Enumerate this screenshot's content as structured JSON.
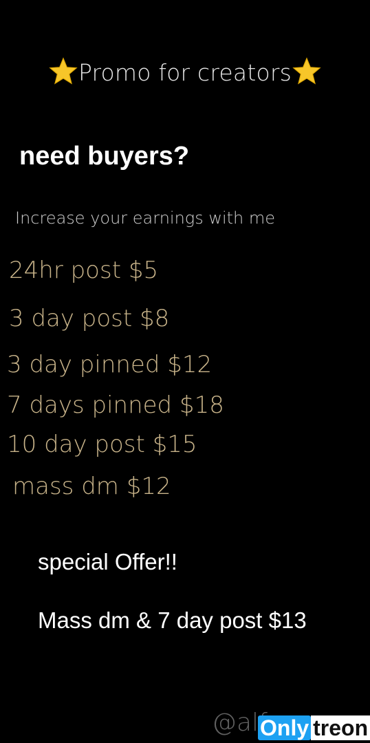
{
  "colors": {
    "background": "#000000",
    "heading": "#ffffff",
    "price_text": "#c9b48a",
    "star": "#f7c629",
    "brand_blue": "#1da1f2"
  },
  "header": {
    "title": "Promo for creators",
    "left_icon": "star-icon",
    "right_icon": "star-icon"
  },
  "headline": "need buyers?",
  "subline": "Increase your earnings with me",
  "prices": [
    "24hr post $5",
    "3 day post $8",
    "3 day pinned $12",
    "7 days pinned $18",
    "10 day post $15",
    "mass dm $12"
  ],
  "offer": {
    "title": "special Offer!!",
    "detail": "Mass dm & 7 day post $13"
  },
  "watermark": {
    "handle": "@alf",
    "brand_left": "Only",
    "brand_right": "treon"
  }
}
